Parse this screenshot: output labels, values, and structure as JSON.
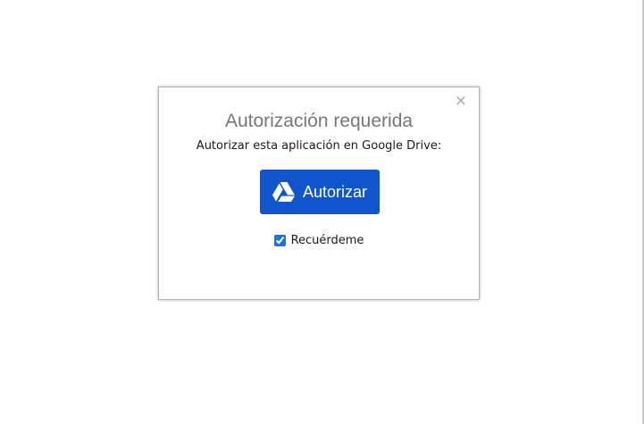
{
  "dialog": {
    "close_label": "×",
    "title": "Autorización requerida",
    "subtitle": "Autorizar esta aplicación en Google Drive:",
    "authorize_label": "Autorizar",
    "authorize_icon": "google-drive-icon",
    "remember_label": "Recuérdeme",
    "remember_checked": true
  },
  "colors": {
    "button": "#1155cc",
    "title": "#777777",
    "close": "#9aa7b5"
  }
}
